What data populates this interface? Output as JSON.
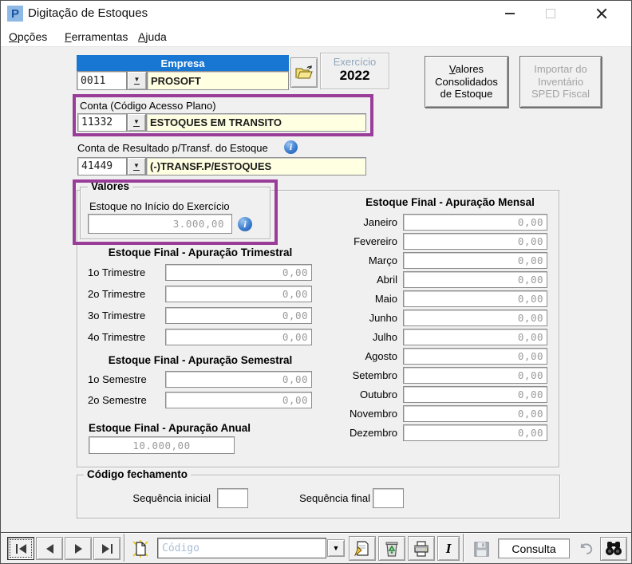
{
  "window": {
    "title": "Digitação de Estoques"
  },
  "menu": {
    "items": [
      {
        "accel": "O",
        "rest": "pções"
      },
      {
        "accel": "F",
        "rest": "erramentas"
      },
      {
        "accel": "A",
        "rest": "juda"
      }
    ]
  },
  "icons": {
    "dropdown": "▼",
    "combo_arrow": "▼"
  },
  "empresa": {
    "header": "Empresa",
    "code": "0011",
    "name": "PROSOFT"
  },
  "exercicio": {
    "label": "Exercício",
    "value": "2022"
  },
  "actions": {
    "consolidados": {
      "accel": "V",
      "rest": "alores",
      "line2": "Consolidados",
      "line3": "de Estoque"
    },
    "importar": {
      "line1": "Importar do",
      "line2": "Inventário",
      "line3": "SPED Fiscal"
    }
  },
  "conta": {
    "label": "Conta (Código Acesso Plano)",
    "code": "11332",
    "desc": "ESTOQUES EM TRANSITO"
  },
  "conta_resultado": {
    "label": "Conta de Resultado p/Transf. do Estoque",
    "code": "41449",
    "desc": "(-)TRANSF.P/ESTOQUES",
    "info_glyph": "i"
  },
  "valores": {
    "legend": "Valores",
    "inicio_label": "Estoque no Início do Exercício",
    "inicio_value": "3.000,00",
    "info_glyph": "i"
  },
  "trimestral": {
    "title": "Estoque Final - Apuração Trimestral",
    "rows": [
      {
        "label": "1o Trimestre",
        "value": "0,00"
      },
      {
        "label": "2o Trimestre",
        "value": "0,00"
      },
      {
        "label": "3o Trimestre",
        "value": "0,00"
      },
      {
        "label": "4o Trimestre",
        "value": "0,00"
      }
    ]
  },
  "semestral": {
    "title": "Estoque Final - Apuração Semestral",
    "rows": [
      {
        "label": "1o Semestre",
        "value": "0,00"
      },
      {
        "label": "2o Semestre",
        "value": "0,00"
      }
    ]
  },
  "anual": {
    "title": "Estoque Final - Apuração Anual",
    "value": "10.000,00"
  },
  "mensal": {
    "title": "Estoque Final - Apuração Mensal",
    "rows": [
      {
        "label": "Janeiro",
        "value": "0,00"
      },
      {
        "label": "Fevereiro",
        "value": "0,00"
      },
      {
        "label": "Março",
        "value": "0,00"
      },
      {
        "label": "Abril",
        "value": "0,00"
      },
      {
        "label": "Maio",
        "value": "0,00"
      },
      {
        "label": "Junho",
        "value": "0,00"
      },
      {
        "label": "Julho",
        "value": "0,00"
      },
      {
        "label": "Agosto",
        "value": "0,00"
      },
      {
        "label": "Setembro",
        "value": "0,00"
      },
      {
        "label": "Outubro",
        "value": "0,00"
      },
      {
        "label": "Novembro",
        "value": "0,00"
      },
      {
        "label": "Dezembro",
        "value": "0,00"
      }
    ]
  },
  "fechamento": {
    "legend": "Código fechamento",
    "seq_inicial_label": "Sequência inicial",
    "seq_final_label": "Sequência final"
  },
  "toolbar": {
    "combo_placeholder": "Código",
    "status": "Consulta",
    "italic_glyph": "I"
  },
  "colors": {
    "accent_blue": "#1877d2",
    "highlight_purple": "#993d99",
    "field_yellow": "#ffffe1"
  }
}
